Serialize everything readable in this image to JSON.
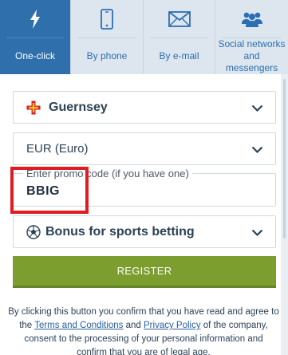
{
  "tabs": [
    {
      "label": "One-click",
      "icon": "lightning-icon",
      "active": true
    },
    {
      "label": "By phone",
      "icon": "phone-icon",
      "active": false
    },
    {
      "label": "By e-mail",
      "icon": "envelope-icon",
      "active": false
    },
    {
      "label": "Social networks and messengers",
      "icon": "users-icon",
      "active": false
    }
  ],
  "form": {
    "country": {
      "value": "Guernsey",
      "icon": "flag-icon"
    },
    "currency": {
      "value": "EUR (Euro)"
    },
    "promo": {
      "legend": "Enter promo code (if you have one)",
      "value": "BBIG"
    },
    "bonus": {
      "value": "Bonus for sports betting",
      "icon": "soccer-ball-icon"
    },
    "register_label": "REGISTER"
  },
  "disclaimer": {
    "part1": "By clicking this button you confirm that you have read and agree to the ",
    "terms_link": "Terms and Conditions",
    "part2": " and ",
    "privacy_link": "Privacy Policy",
    "part3": " of the company, consent to the processing of your personal information and confirm that you are of legal age."
  },
  "colors": {
    "active_tab": "#2f6fac",
    "inactive_tab": "#dde6ee",
    "register": "#7b9e2f",
    "highlight": "#e01b22",
    "text": "#2b4256"
  }
}
